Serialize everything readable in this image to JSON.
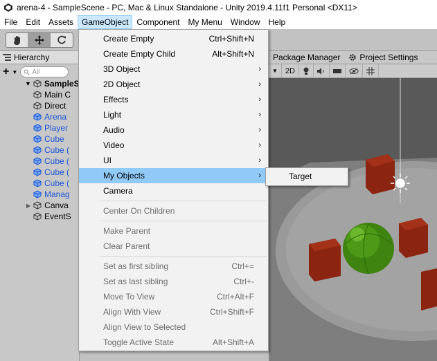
{
  "window": {
    "title": "arena-4 - SampleScene - PC, Mac & Linux Standalone - Unity 2019.4.11f1 Personal <DX11>"
  },
  "menubar": [
    "File",
    "Edit",
    "Assets",
    "GameObject",
    "Component",
    "My Menu",
    "Window",
    "Help"
  ],
  "menubar_active": "GameObject",
  "hierarchy": {
    "tab_label": "Hierarchy",
    "add_label": "+",
    "search_placeholder": "All",
    "scene_name": "SampleS",
    "items": [
      {
        "label": "Main C",
        "prefab": false
      },
      {
        "label": "Direct",
        "prefab": false
      },
      {
        "label": "Arena",
        "prefab": true
      },
      {
        "label": "Player",
        "prefab": true
      },
      {
        "label": "Cube",
        "prefab": true
      },
      {
        "label": "Cube (",
        "prefab": true
      },
      {
        "label": "Cube (",
        "prefab": true
      },
      {
        "label": "Cube (",
        "prefab": true
      },
      {
        "label": "Cube (",
        "prefab": true
      },
      {
        "label": "Manag",
        "prefab": true
      },
      {
        "label": "Canva",
        "prefab": false
      },
      {
        "label": "EventS",
        "prefab": false
      }
    ]
  },
  "scene_view": {
    "tabs": [
      "Package Manager",
      "Project Settings"
    ],
    "toolbar_2d": "2D"
  },
  "gameobject_menu": {
    "create_empty": {
      "label": "Create Empty",
      "shortcut": "Ctrl+Shift+N"
    },
    "create_empty_child": {
      "label": "Create Empty Child",
      "shortcut": "Alt+Shift+N"
    },
    "object_3d": "3D Object",
    "object_2d": "2D Object",
    "effects": "Effects",
    "light": "Light",
    "audio": "Audio",
    "video": "Video",
    "ui": "UI",
    "my_objects": "My Objects",
    "camera": "Camera",
    "center_on_children": "Center On Children",
    "make_parent": "Make Parent",
    "clear_parent": "Clear Parent",
    "set_first_sibling": {
      "label": "Set as first sibling",
      "shortcut": "Ctrl+="
    },
    "set_last_sibling": {
      "label": "Set as last sibling",
      "shortcut": "Ctrl+-"
    },
    "move_to_view": {
      "label": "Move To View",
      "shortcut": "Ctrl+Alt+F"
    },
    "align_with_view": {
      "label": "Align With View",
      "shortcut": "Ctrl+Shift+F"
    },
    "align_view_to_selected": "Align View to Selected",
    "toggle_active_state": {
      "label": "Toggle Active State",
      "shortcut": "Alt+Shift+A"
    }
  },
  "my_objects_submenu": [
    "Target"
  ],
  "colors": {
    "menu_highlight": "#91c9f7",
    "menubar_active": "#cce8ff",
    "prefab_text": "#1b55d4",
    "cube_red": "#8b2410",
    "sphere_green": "#4e9a16"
  }
}
